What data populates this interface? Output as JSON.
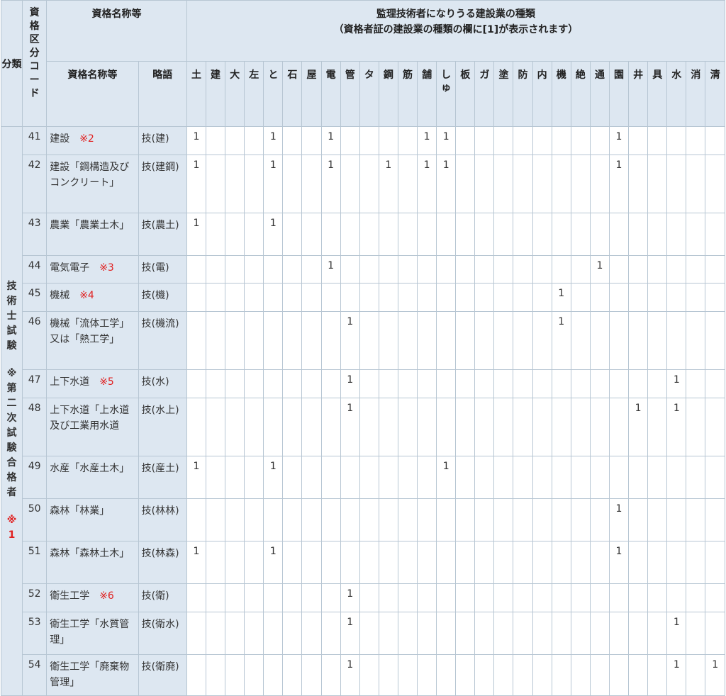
{
  "header": {
    "bunrui": "分類",
    "code_chars": [
      "資",
      "格",
      "区",
      "分",
      "コ",
      "ー",
      "ド"
    ],
    "qual_group": "資格名称等",
    "qual_name": "資格名称等",
    "abbr": "略語",
    "title_line1": "監理技術者になりうる建設業の種類",
    "title_line2": "（資格者証の建設業の種類の欄に[1]が表示されます）"
  },
  "kinds": [
    "土",
    "建",
    "大",
    "左",
    "と",
    "石",
    "屋",
    "電",
    "管",
    "タ",
    "鋼",
    "筋",
    "舗",
    "しゅ",
    "板",
    "ガ",
    "塗",
    "防",
    "内",
    "機",
    "絶",
    "通",
    "園",
    "井",
    "具",
    "水",
    "消",
    "清"
  ],
  "bunrui": {
    "chars": [
      "技",
      "術",
      "士",
      "試",
      "験",
      "",
      "※",
      "第",
      "二",
      "次",
      "試",
      "験",
      "合",
      "格",
      "者"
    ],
    "note": [
      "※",
      "1"
    ]
  },
  "rows": [
    {
      "code": "41",
      "name": "建設",
      "note": "※2",
      "abbr": "技(建)",
      "height": 40,
      "values": [
        "1",
        "",
        "",
        "",
        "1",
        "",
        "",
        "1",
        "",
        "",
        "",
        "",
        "1",
        "1",
        "",
        "",
        "",
        "",
        "",
        "",
        "",
        "",
        "1",
        "",
        "",
        "",
        "",
        ""
      ]
    },
    {
      "code": "42",
      "name": "建設「鋼構造及びコンクリート」",
      "note": "",
      "abbr": "技(建鋼)",
      "height": 82,
      "values": [
        "1",
        "",
        "",
        "",
        "1",
        "",
        "",
        "1",
        "",
        "",
        "1",
        "",
        "1",
        "1",
        "",
        "",
        "",
        "",
        "",
        "",
        "",
        "",
        "1",
        "",
        "",
        "",
        "",
        ""
      ]
    },
    {
      "code": "43",
      "name": "農業「農業土木」",
      "note": "",
      "abbr": "技(農土)",
      "height": 60,
      "values": [
        "1",
        "",
        "",
        "",
        "1",
        "",
        "",
        "",
        "",
        "",
        "",
        "",
        "",
        "",
        "",
        "",
        "",
        "",
        "",
        "",
        "",
        "",
        "",
        "",
        "",
        "",
        "",
        ""
      ]
    },
    {
      "code": "44",
      "name": "電気電子",
      "note": "※3",
      "abbr": "技(電)",
      "height": 39,
      "values": [
        "",
        "",
        "",
        "",
        "",
        "",
        "",
        "1",
        "",
        "",
        "",
        "",
        "",
        "",
        "",
        "",
        "",
        "",
        "",
        "",
        "",
        "1",
        "",
        "",
        "",
        "",
        "",
        ""
      ]
    },
    {
      "code": "45",
      "name": "機械",
      "note": "※4",
      "abbr": "技(機)",
      "height": 40,
      "values": [
        "",
        "",
        "",
        "",
        "",
        "",
        "",
        "",
        "",
        "",
        "",
        "",
        "",
        "",
        "",
        "",
        "",
        "",
        "",
        "1",
        "",
        "",
        "",
        "",
        "",
        "",
        "",
        ""
      ]
    },
    {
      "code": "46",
      "name": "機械「流体工学」又は「熱工学」",
      "note": "",
      "abbr": "技(機流)",
      "height": 82,
      "values": [
        "",
        "",
        "",
        "",
        "",
        "",
        "",
        "",
        "1",
        "",
        "",
        "",
        "",
        "",
        "",
        "",
        "",
        "",
        "",
        "1",
        "",
        "",
        "",
        "",
        "",
        "",
        "",
        ""
      ]
    },
    {
      "code": "47",
      "name": "上下水道",
      "note": "※5",
      "abbr": "技(水)",
      "height": 40,
      "values": [
        "",
        "",
        "",
        "",
        "",
        "",
        "",
        "",
        "1",
        "",
        "",
        "",
        "",
        "",
        "",
        "",
        "",
        "",
        "",
        "",
        "",
        "",
        "",
        "",
        "",
        "1",
        "",
        ""
      ]
    },
    {
      "code": "48",
      "name": "上下水道「上水道及び工業用水道",
      "note": "",
      "abbr": "技(水上)",
      "height": 82,
      "values": [
        "",
        "",
        "",
        "",
        "",
        "",
        "",
        "",
        "1",
        "",
        "",
        "",
        "",
        "",
        "",
        "",
        "",
        "",
        "",
        "",
        "",
        "",
        "",
        "1",
        "",
        "1",
        "",
        ""
      ]
    },
    {
      "code": "49",
      "name": "水産「水産土木」",
      "note": "",
      "abbr": "技(産土)",
      "height": 60,
      "values": [
        "1",
        "",
        "",
        "",
        "1",
        "",
        "",
        "",
        "",
        "",
        "",
        "",
        "",
        "1",
        "",
        "",
        "",
        "",
        "",
        "",
        "",
        "",
        "",
        "",
        "",
        "",
        "",
        ""
      ]
    },
    {
      "code": "50",
      "name": "森林「林業」",
      "note": "",
      "abbr": "技(林林)",
      "height": 60,
      "values": [
        "",
        "",
        "",
        "",
        "",
        "",
        "",
        "",
        "",
        "",
        "",
        "",
        "",
        "",
        "",
        "",
        "",
        "",
        "",
        "",
        "",
        "",
        "1",
        "",
        "",
        "",
        "",
        ""
      ]
    },
    {
      "code": "51",
      "name": "森林「森林土木」",
      "note": "",
      "abbr": "技(林森)",
      "height": 60,
      "values": [
        "1",
        "",
        "",
        "",
        "1",
        "",
        "",
        "",
        "",
        "",
        "",
        "",
        "",
        "",
        "",
        "",
        "",
        "",
        "",
        "",
        "",
        "",
        "1",
        "",
        "",
        "",
        "",
        ""
      ]
    },
    {
      "code": "52",
      "name": "衛生工学",
      "note": "※6",
      "abbr": "技(衛)",
      "height": 40,
      "values": [
        "",
        "",
        "",
        "",
        "",
        "",
        "",
        "",
        "1",
        "",
        "",
        "",
        "",
        "",
        "",
        "",
        "",
        "",
        "",
        "",
        "",
        "",
        "",
        "",
        "",
        "",
        "",
        ""
      ]
    },
    {
      "code": "53",
      "name": "衛生工学「水質管理」",
      "note": "",
      "abbr": "技(衛水)",
      "height": 60,
      "values": [
        "",
        "",
        "",
        "",
        "",
        "",
        "",
        "",
        "1",
        "",
        "",
        "",
        "",
        "",
        "",
        "",
        "",
        "",
        "",
        "",
        "",
        "",
        "",
        "",
        "",
        "1",
        "",
        ""
      ]
    },
    {
      "code": "54",
      "name": "衛生工学「廃棄物管理」",
      "note": "",
      "abbr": "技(衛廃)",
      "height": 58,
      "values": [
        "",
        "",
        "",
        "",
        "",
        "",
        "",
        "",
        "1",
        "",
        "",
        "",
        "",
        "",
        "",
        "",
        "",
        "",
        "",
        "",
        "",
        "",
        "",
        "",
        "",
        "1",
        "",
        "1"
      ]
    }
  ]
}
